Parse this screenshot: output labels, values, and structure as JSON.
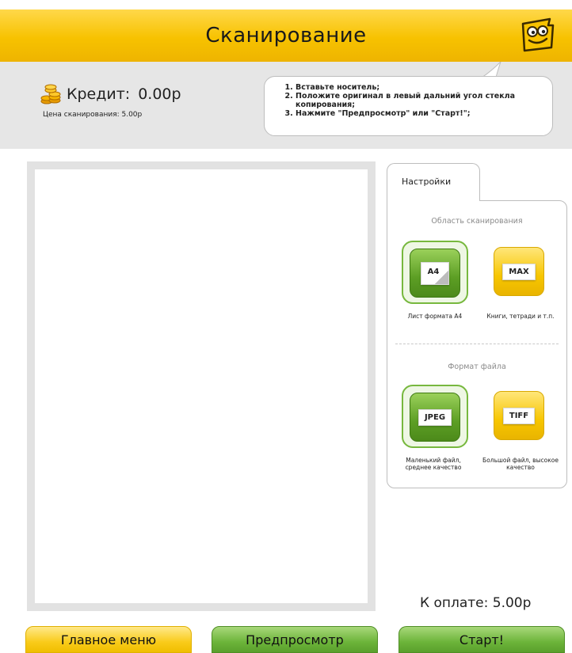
{
  "header": {
    "title": "Сканирование"
  },
  "info": {
    "credit_label": "Кредит:",
    "credit_value": "0.00р",
    "price_text": "Цена сканирования: 5.00р",
    "instructions": [
      "Вставьте носитель;",
      "Положите оригинал в левый дальний угол стекла копирования;",
      "Нажмите \"Предпросмотр\" или \"Старт!\";"
    ]
  },
  "settings": {
    "tab_label": "Настройки",
    "scan_area": {
      "label": "Область сканирования",
      "options": [
        {
          "badge": "A4",
          "caption": "Лист формата А4",
          "selected": true
        },
        {
          "badge": "MAX",
          "caption": "Книги, тетради и т.п.",
          "selected": false
        }
      ]
    },
    "file_format": {
      "label": "Формат файла",
      "options": [
        {
          "badge": "JPEG",
          "caption": "Маленький файл, среднее качество",
          "selected": true
        },
        {
          "badge": "TIFF",
          "caption": "Большой файл, высокое качество",
          "selected": false
        }
      ]
    }
  },
  "footer": {
    "amount_text": "К оплате: 5.00р",
    "main_menu": "Главное меню",
    "preview": "Предпросмотр",
    "start": "Старт!"
  },
  "colors": {
    "header": "#f7c200",
    "info_band": "#e6e6e6",
    "accent_green": "#5c9e24",
    "accent_yellow": "#f7c600"
  },
  "icons": {
    "mascot": "mascot-icon",
    "coins": "coins-icon"
  }
}
